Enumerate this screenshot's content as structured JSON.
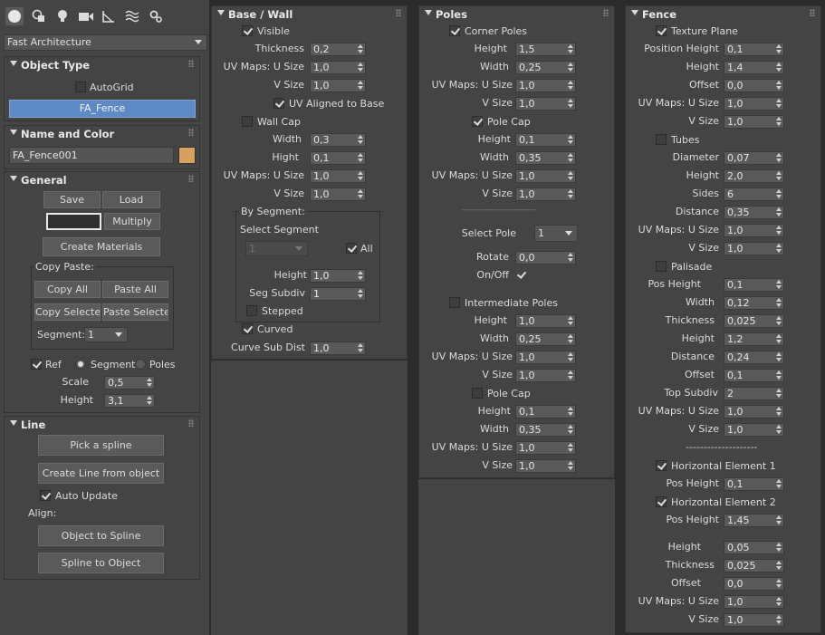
{
  "tabs": {
    "icons": [
      "sphere-icon",
      "shapes-icon",
      "light-icon",
      "camera-icon",
      "helpers-icon",
      "spacewarps-icon",
      "systems-icon"
    ]
  },
  "category": {
    "value": "Fast Architecture"
  },
  "object_type": {
    "title": "Object Type",
    "autogrid": "AutoGrid",
    "button": "FA_Fence"
  },
  "name_color": {
    "title": "Name and Color",
    "name": "FA_Fence001",
    "color": "#d7a25f"
  },
  "general": {
    "title": "General",
    "save": "Save",
    "load": "Load",
    "multiply": "Multiply",
    "create_materials": "Create Materials",
    "copy_paste": "Copy Paste:",
    "copy_all": "Copy All",
    "paste_all": "Paste All",
    "copy_selected": "Copy Selected",
    "paste_selected": "Paste Selected",
    "segment_label": "Segment:",
    "segment_value": "1",
    "ref": "Ref",
    "segment": "Segment",
    "poles": "Poles",
    "scale_label": "Scale",
    "scale": "0,5",
    "height_label": "Height",
    "height": "3,1"
  },
  "line": {
    "title": "Line",
    "pick": "Pick a spline",
    "create": "Create Line from object",
    "auto_update": "Auto Update",
    "align": "Align:",
    "obj_to_spline": "Object to Spline",
    "spline_to_obj": "Spline to Object"
  },
  "base": {
    "title": "Base / Wall",
    "visible": "Visible",
    "thickness_label": "Thickness",
    "thickness": "0,2",
    "uvu_label": "UV Maps: U Size",
    "uvu": "1,0",
    "vsize_label": "V Size",
    "vsize": "1,0",
    "uv_aligned": "UV Aligned to Base",
    "wall_cap": "Wall Cap",
    "width_label": "Width",
    "width": "0,3",
    "hight_label": "Hight",
    "hight": "0,1",
    "uvu2": "1,0",
    "vsize2": "1,0",
    "by_segment": "By Segment:",
    "select_segment": "Select Segment",
    "seg_dd": "1",
    "all": "All",
    "seg_height_label": "Height",
    "seg_height": "1,0",
    "seg_subdiv_label": "Seg Subdiv",
    "seg_subdiv": "1",
    "stepped": "Stepped",
    "curved": "Curved",
    "curve_sub_label": "Curve Sub Dist",
    "curve_sub": "1,0"
  },
  "poles": {
    "title": "Poles",
    "corner_poles": "Corner Poles",
    "height_label": "Height",
    "height": "1,5",
    "width_label": "Width",
    "width": "0,25",
    "uvu_label": "UV Maps: U Size",
    "uvu": "1,0",
    "vsize_label": "V Size",
    "vsize": "1,0",
    "pole_cap": "Pole Cap",
    "cap_height": "0,1",
    "cap_width": "0,35",
    "cap_uvu": "1,0",
    "cap_vsize": "1,0",
    "divider": "------------------------------------",
    "select_pole_label": "Select Pole",
    "select_pole": "1",
    "rotate_label": "Rotate",
    "rotate": "0,0",
    "onoff_label": "On/Off",
    "intermediate": "Intermediate Poles",
    "i_height": "1,0",
    "i_width": "0,25",
    "i_uvu": "1,0",
    "i_vsize": "1,0",
    "i_pole_cap": "Pole Cap",
    "ic_height": "0,1",
    "ic_width": "0,35",
    "ic_uvu": "1,0",
    "ic_vsize": "1,0"
  },
  "fence": {
    "title": "Fence",
    "texture_plane": "Texture Plane",
    "pos_height_label": "Position Height",
    "pos_height": "0,1",
    "height_label": "Height",
    "height": "1,4",
    "offset_label": "Offset",
    "offset": "0,0",
    "uvu_label": "UV Maps: U Size",
    "uvu": "1,0",
    "vsize_label": "V Size",
    "vsize": "1,0",
    "tubes": "Tubes",
    "diameter_label": "Diameter",
    "diameter": "0,07",
    "t_height": "2,0",
    "sides_label": "Sides",
    "sides": "6",
    "distance_label": "Distance",
    "t_distance": "0,35",
    "t_uvu": "1,0",
    "t_vsize": "1,0",
    "palisade": "Palisade",
    "p_pos_height_label": "Pos Height",
    "p_pos_height": "0,1",
    "width_label": "Width",
    "p_width": "0,12",
    "thickness_label": "Thickness",
    "p_thickness": "0,025",
    "p_height": "1,2",
    "p_distance": "0,24",
    "p_offset": "0,1",
    "top_subdiv_label": "Top Subdiv",
    "p_top_subdiv": "2",
    "p_uvu": "1,0",
    "p_vsize": "1,0",
    "divider": "--------------------",
    "h1": "Horizontal Element 1",
    "h1_pos_height": "0,1",
    "h2": "Horizontal Element 2",
    "h2_pos_height": "1,45",
    "h_height": "0,05",
    "h_thickness": "0,025",
    "h_offset": "0,0",
    "h_uvu": "1,0",
    "h_vsize": "1,0"
  }
}
